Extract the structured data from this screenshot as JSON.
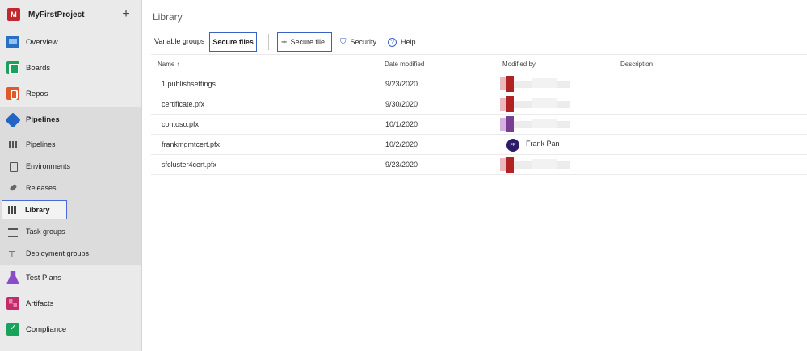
{
  "project": {
    "initial": "M",
    "name": "MyFirstProject",
    "add_glyph": "+"
  },
  "nav": {
    "overview": "Overview",
    "boards": "Boards",
    "repos": "Repos",
    "pipelines": "Pipelines",
    "pipelines_sub": {
      "pipelines": "Pipelines",
      "environments": "Environments",
      "releases": "Releases",
      "library": "Library",
      "task_groups": "Task groups",
      "deployment_groups": "Deployment groups"
    },
    "test_plans": "Test Plans",
    "artifacts": "Artifacts",
    "compliance": "Compliance"
  },
  "page": {
    "title": "Library"
  },
  "tabs": {
    "variable_groups": "Variable groups",
    "secure_files": "Secure files"
  },
  "toolbar": {
    "secure_file": "Secure file",
    "secure_file_glyph": "+",
    "security": "Security",
    "security_glyph": "⛉",
    "help": "Help",
    "help_glyph": "?"
  },
  "table": {
    "headers": {
      "name": "Name ↑",
      "date": "Date modified",
      "by": "Modified by",
      "description": "Description"
    },
    "rows": [
      {
        "name": "1.publishsettings",
        "date": "9/23/2020"
      },
      {
        "name": "certificate.pfx",
        "date": "9/30/2020"
      },
      {
        "name": "contoso.pfx",
        "date": "10/1/2020"
      },
      {
        "name": "frankmgmtcert.pfx",
        "date": "10/2/2020",
        "initials": "FP",
        "modified_by": "Frank Pan"
      },
      {
        "name": "sfcluster4cert.pfx",
        "date": "9/23/2020"
      }
    ]
  }
}
